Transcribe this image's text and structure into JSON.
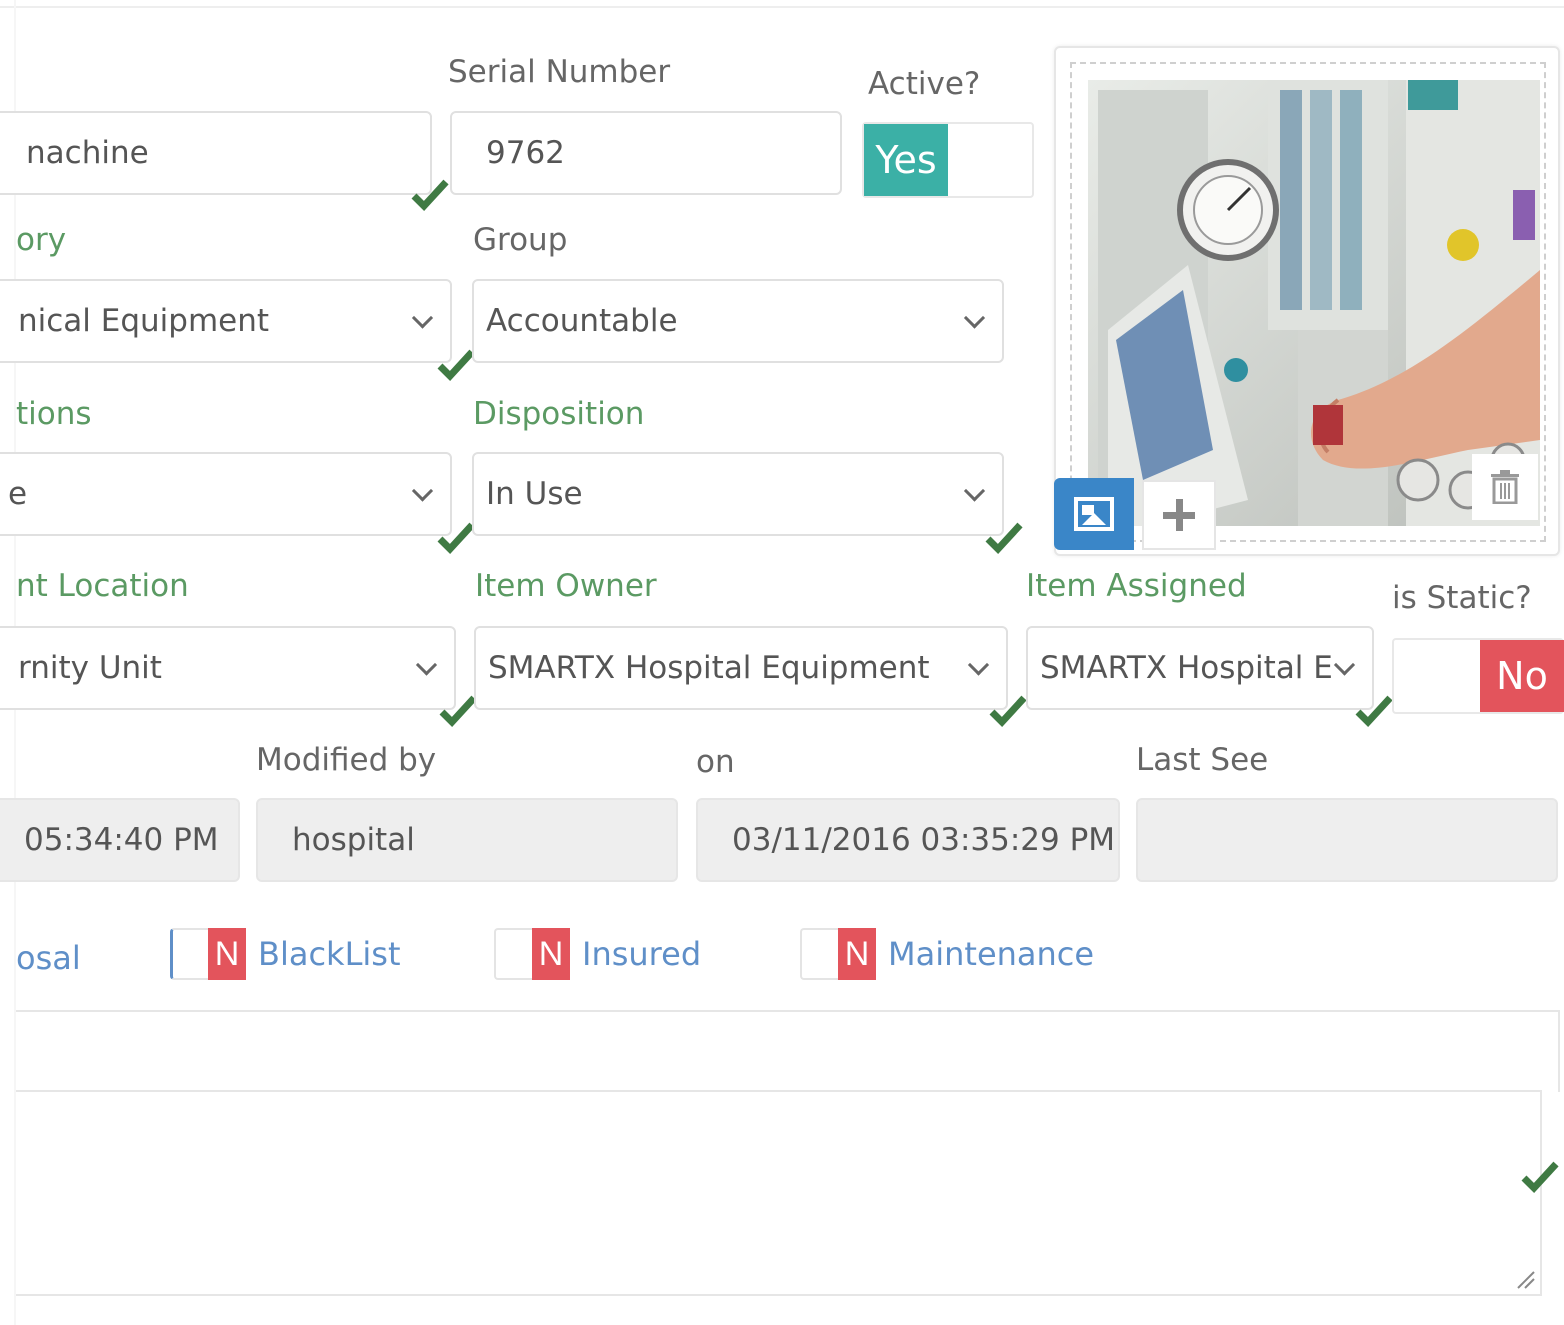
{
  "labels": {
    "serial_number": "Serial Number",
    "active": "Active?",
    "category_partial": "ory",
    "group": "Group",
    "conditions_partial": "tions",
    "disposition": "Disposition",
    "location_partial": "nt Location",
    "item_owner": "Item Owner",
    "item_assigned": "Item Assigned",
    "is_static": "is Static?",
    "modified_by": "Modified by",
    "modified_on": "on",
    "last_seen": "Last See"
  },
  "fields": {
    "name_value": "nachine",
    "serial_value": "9762",
    "active_value": "Yes",
    "category_value": "nical Equipment",
    "group_value": "Accountable",
    "condition_value": "e",
    "disposition_value": "In Use",
    "location_value": "rnity Unit",
    "owner_value": "SMARTX Hospital Equipment",
    "assigned_value": "SMARTX Hospital E",
    "is_static_value": "No",
    "created_on_value": "05:34:40 PM",
    "modified_by_value": "hospital",
    "modified_on_value": "03/11/2016 03:35:29 PM",
    "last_seen_value": ""
  },
  "flags": [
    {
      "label": "osal",
      "partial": true
    },
    {
      "label": "BlackList",
      "state": "N"
    },
    {
      "label": "Insured",
      "state": "N"
    },
    {
      "label": "Maintenance",
      "state": "N"
    }
  ],
  "image_panel": {
    "photo_alt": "anesthesia machine photo",
    "buttons": [
      "image-icon",
      "plus-icon",
      "trash-icon"
    ]
  },
  "colors": {
    "active_yes": "#3bb0a6",
    "static_no": "#e3545c",
    "check": "#3f7a43",
    "label_green": "#5b9a63",
    "flag_blue": "#5f8fc8",
    "image_button": "#3a86c8"
  }
}
